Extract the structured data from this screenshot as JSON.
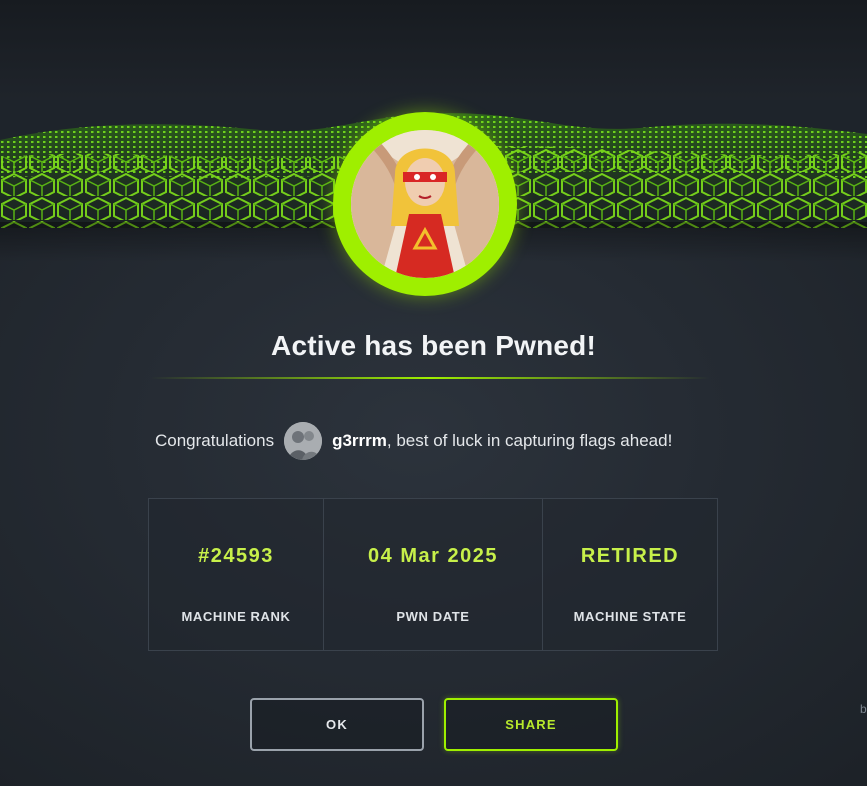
{
  "modal": {
    "title": "Active has been Pwned!",
    "congrats_prefix": "Congratulations",
    "username": "g3rrrm",
    "congrats_suffix": ", best of luck in capturing flags ahead!"
  },
  "stats": [
    {
      "value": "#24593",
      "label": "MACHINE RANK"
    },
    {
      "value": "04 Mar 2025",
      "label": "PWN DATE"
    },
    {
      "value": "RETIRED",
      "label": "MACHINE STATE"
    }
  ],
  "buttons": {
    "ok_label": "OK",
    "share_label": "SHARE"
  },
  "edge_text": "b",
  "icons": {
    "machine_avatar": "hooded-superhero-avatar",
    "user_avatar": "user-avatar",
    "banner": "green-cube-wave-banner"
  },
  "colors": {
    "accent": "#9fef00",
    "stat_value": "#c7f04a",
    "background": "#252b33",
    "text": "#f2f4f6",
    "button_border": "#9aa2ab"
  }
}
